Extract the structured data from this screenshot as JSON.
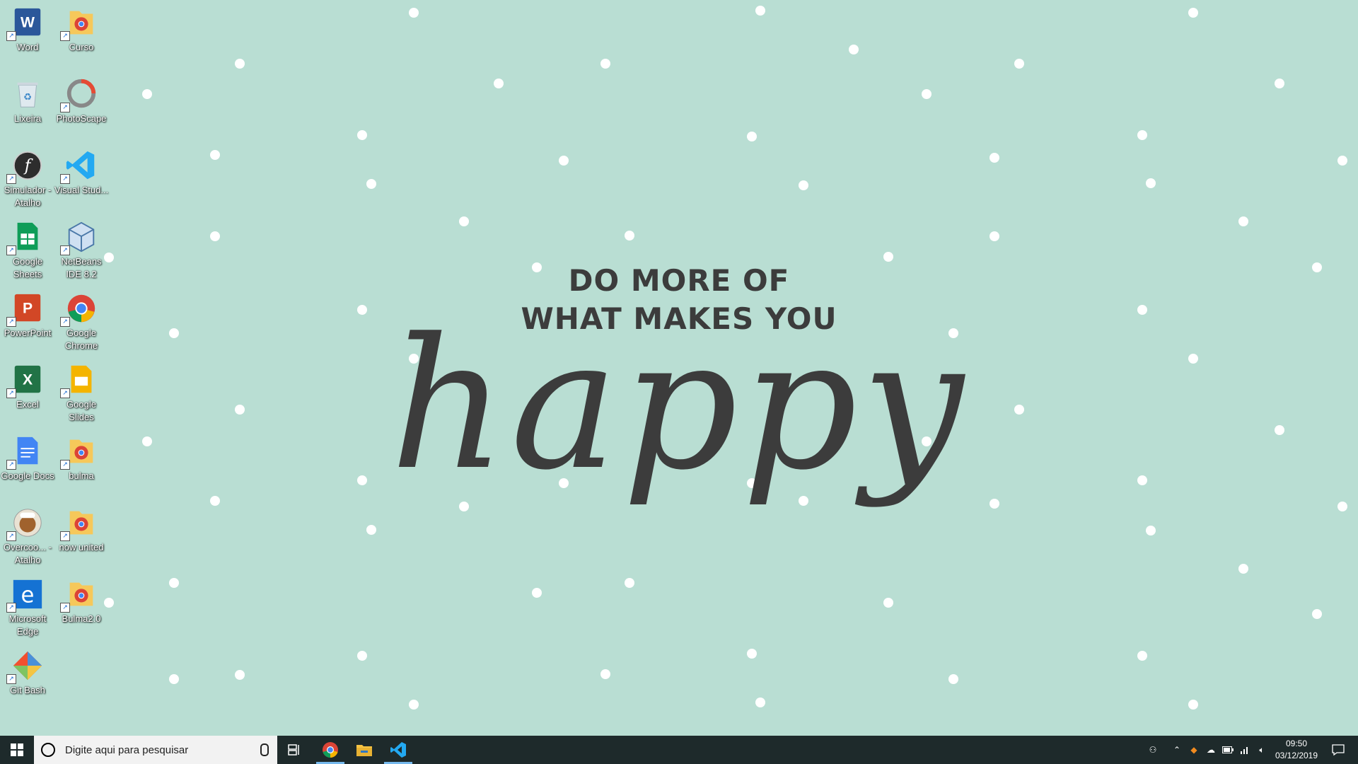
{
  "wallpaper": {
    "line1": "DO MORE OF",
    "line2": "WHAT MAKES YOU",
    "script": "happy",
    "background_color": "#b9ded3",
    "dot_color": "#ffffff",
    "text_color": "#3c3c3c"
  },
  "desktop_icons": [
    {
      "label": "Word",
      "icon": "word-icon"
    },
    {
      "label": "Curso",
      "icon": "chrome-folder-icon"
    },
    {
      "label": "Lixeira",
      "icon": "recycle-bin-icon"
    },
    {
      "label": "PhotoScape",
      "icon": "photoscape-icon"
    },
    {
      "label": "Simulador - Atalho",
      "icon": "flash-icon"
    },
    {
      "label": "Visual Stud...",
      "icon": "vscode-icon"
    },
    {
      "label": "Google Sheets",
      "icon": "sheets-icon"
    },
    {
      "label": "NetBeans IDE 8.2",
      "icon": "netbeans-icon"
    },
    {
      "label": "PowerPoint",
      "icon": "powerpoint-icon"
    },
    {
      "label": "Google Chrome",
      "icon": "chrome-icon"
    },
    {
      "label": "Excel",
      "icon": "excel-icon"
    },
    {
      "label": "Google Slides",
      "icon": "slides-icon"
    },
    {
      "label": "Google Docs",
      "icon": "docs-icon"
    },
    {
      "label": "bulma",
      "icon": "chrome-folder-icon"
    },
    {
      "label": "Overcoo... - Atalho",
      "icon": "overcooked-icon"
    },
    {
      "label": "now united",
      "icon": "chrome-folder-icon"
    },
    {
      "label": "Microsoft Edge",
      "icon": "edge-icon"
    },
    {
      "label": "Bulma2.0",
      "icon": "chrome-folder-icon"
    },
    {
      "label": "Git Bash",
      "icon": "git-icon"
    }
  ],
  "taskbar": {
    "search_placeholder": "Digite aqui para pesquisar",
    "time": "09:50",
    "date": "03/12/2019",
    "pinned": [
      "chrome-icon",
      "file-explorer-icon",
      "vscode-icon"
    ],
    "tray_icons": [
      "people-icon",
      "chevron-up-icon",
      "fox-icon",
      "cloud-icon",
      "battery-icon",
      "network-icon",
      "volume-icon",
      "notification-icon"
    ]
  }
}
